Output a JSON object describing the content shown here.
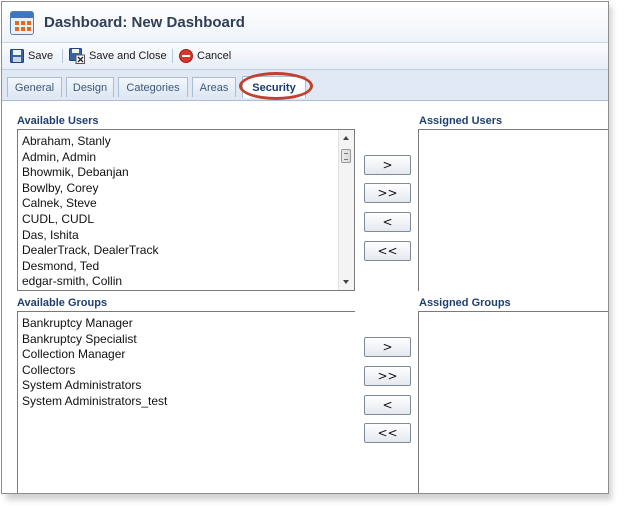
{
  "window": {
    "title": "Dashboard: New Dashboard",
    "app_icon": "dashboard-icon"
  },
  "toolbar": {
    "save_label": "Save",
    "save_close_label": "Save and Close",
    "cancel_label": "Cancel",
    "icons": {
      "save": "floppy-disk-icon",
      "save_close": "floppy-disk-close-icon",
      "cancel": "red-cancel-icon"
    }
  },
  "tabs": [
    {
      "label": "General"
    },
    {
      "label": "Design"
    },
    {
      "label": "Categories"
    },
    {
      "label": "Areas"
    },
    {
      "label": "Security",
      "active": true
    }
  ],
  "users": {
    "available_label": "Available Users",
    "assigned_label": "Assigned Users",
    "available": [
      "Abraham, Stanly",
      "Admin, Admin",
      "Bhowmik, Debanjan",
      "Bowlby, Corey",
      "Calnek, Steve",
      "CUDL, CUDL",
      "Das, Ishita",
      "DealerTrack, DealerTrack",
      "Desmond, Ted",
      "edgar-smith, Collin"
    ],
    "assigned": []
  },
  "groups": {
    "available_label": "Available Groups",
    "assigned_label": "Assigned Groups",
    "available": [
      "Bankruptcy Manager",
      "Bankruptcy Specialist",
      "Collection Manager",
      "Collectors",
      "System Administrators",
      "System Administrators_test"
    ],
    "assigned": []
  },
  "move_buttons": {
    "add": ">",
    "add_all": ">>",
    "remove": "<",
    "remove_all": "<<"
  },
  "colors": {
    "highlight_ring": "#c0412f",
    "section_label": "#1f3f6e",
    "tab_active_text": "#173a6b"
  }
}
